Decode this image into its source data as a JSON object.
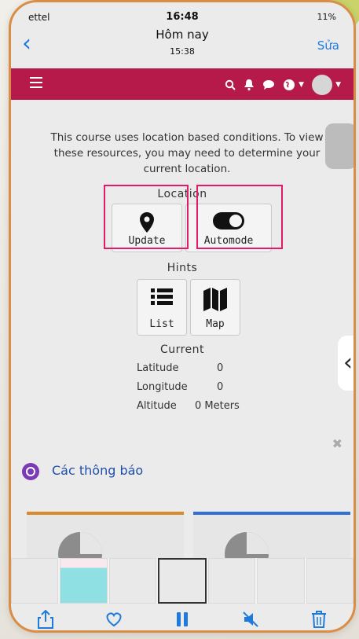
{
  "status_bar": {
    "carrier": "ettel",
    "time": "16:48",
    "battery": "11%"
  },
  "nav": {
    "title": "Hôm nay",
    "subtitle": "15:38",
    "edit_label": "Sửa"
  },
  "header": {
    "accent": "#b51a4a"
  },
  "location_panel": {
    "intro": "This course uses location based conditions. To view these resources, you may need to determine your current location.",
    "location_label": "Location",
    "update_label": "Update",
    "automode_label": "Automode",
    "hints_label": "Hints",
    "list_label": "List",
    "map_label": "Map",
    "current_label": "Current",
    "latitude_label": "Latitude",
    "latitude_value": "0",
    "longitude_label": "Longitude",
    "longitude_value": "0",
    "altitude_label": "Altitude",
    "altitude_value": "0 Meters"
  },
  "announcements": {
    "title": "Các thông báo"
  },
  "cards": [
    {
      "accent": "#d98a2b"
    },
    {
      "accent": "#2f6fd6"
    }
  ],
  "colors": {
    "ios_blue": "#1e7bdc",
    "highlight": "#e3196a",
    "frame": "#d98d46"
  },
  "icons": [
    "search-icon",
    "bell-icon",
    "chat-icon",
    "globe-icon",
    "map-marker-icon",
    "toggle-icon",
    "list-icon",
    "map-icon",
    "share-icon",
    "heart-icon",
    "pause-icon",
    "mute-icon",
    "trash-icon"
  ]
}
